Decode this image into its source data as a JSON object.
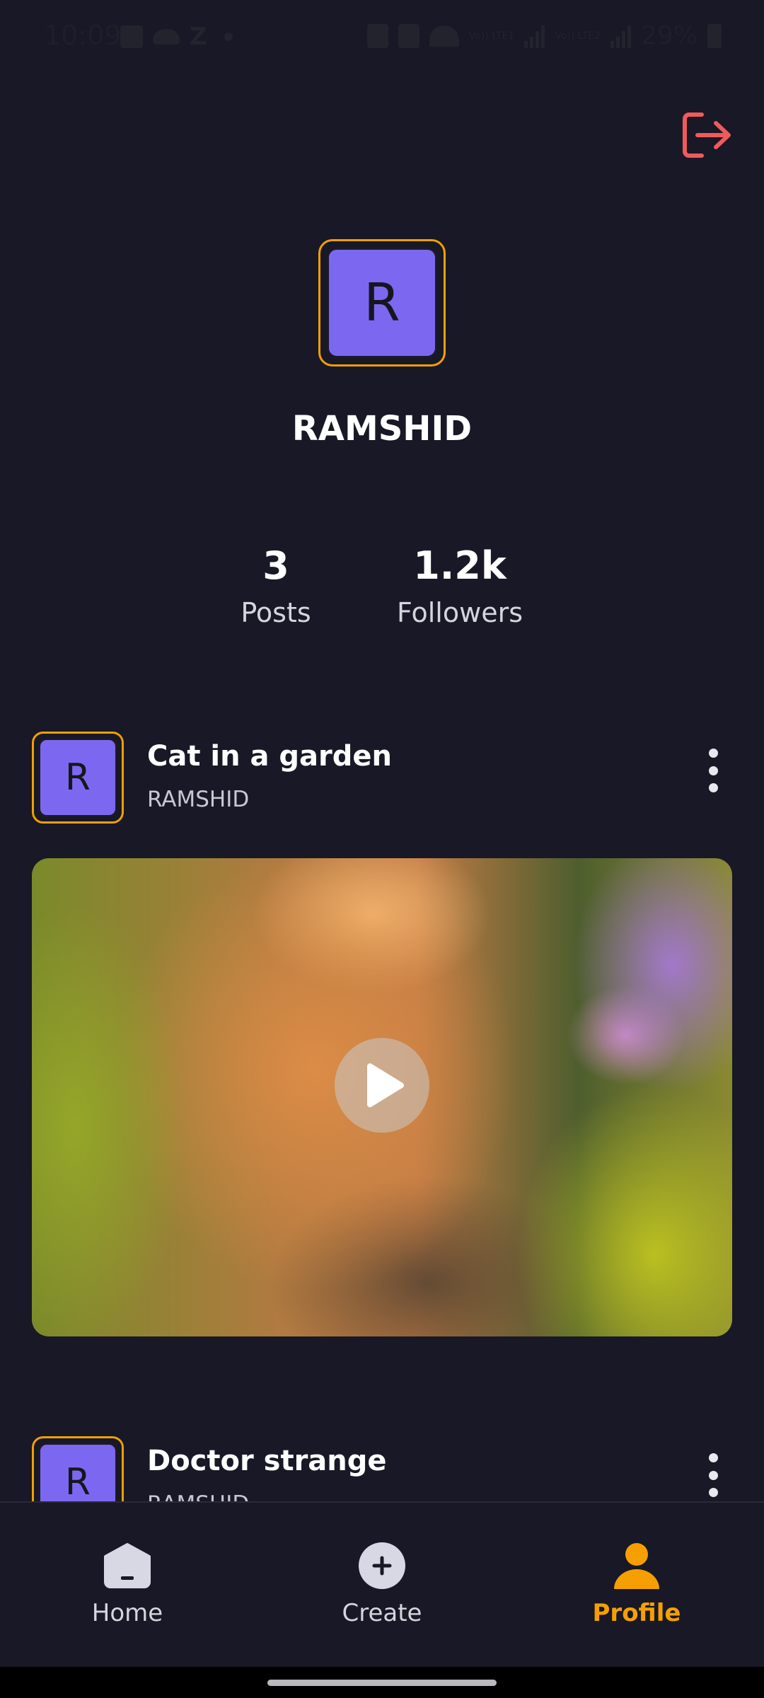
{
  "status_bar": {
    "time": "10:09",
    "battery": "29%",
    "sim1_label": "Vo)) LTE1",
    "sim2_label": "Vo)) LTE2"
  },
  "profile": {
    "avatar_letter": "R",
    "username": "RAMSHID",
    "stats": {
      "posts_value": "3",
      "posts_label": "Posts",
      "followers_value": "1.2k",
      "followers_label": "Followers"
    }
  },
  "posts": [
    {
      "avatar_letter": "R",
      "title": "Cat in a garden",
      "author": "RAMSHID"
    },
    {
      "avatar_letter": "R",
      "title": "Doctor strange",
      "author": "RAMSHID"
    }
  ],
  "nav": {
    "items": [
      {
        "label": "Home",
        "icon": "home-icon"
      },
      {
        "label": "Create",
        "icon": "add-circle-icon"
      },
      {
        "label": "Profile",
        "icon": "person-icon",
        "active": true
      }
    ]
  },
  "colors": {
    "background": "#181826",
    "accent": "#f5a000",
    "avatar_fill": "#7c68f0",
    "logout": "#f05a5a"
  }
}
